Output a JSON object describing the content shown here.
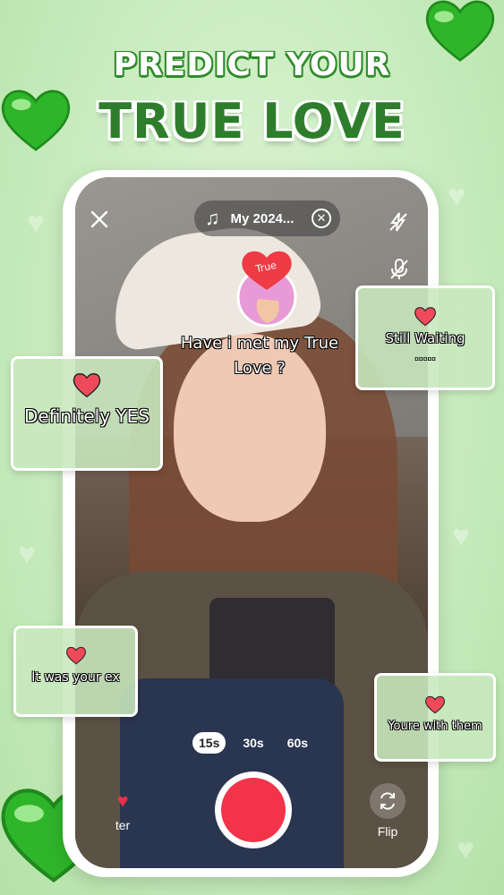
{
  "header": {
    "line1": "PREDICT YOUR",
    "line2": "TRUE LOVE"
  },
  "music": {
    "song": "My 2024..."
  },
  "question": {
    "badge": "True",
    "text": "Have i met my True Love ?"
  },
  "cards": {
    "left_top": "Definitely YES",
    "right_top_line1": "Still Waiting",
    "right_top_line2": ".....",
    "left_bottom": "It was your ex",
    "right_bottom": "Youre with them"
  },
  "durations": [
    "15s",
    "30s",
    "60s"
  ],
  "selected_duration": "15s",
  "controls": {
    "flip_label": "Flip",
    "filter_label_visible": "ter"
  },
  "colors": {
    "accent_green": "#2e7d2c",
    "record_red": "#f2334a",
    "heart_red": "#ef4a5a"
  },
  "icons": [
    "close-icon",
    "music-note-icon",
    "clear-song-icon",
    "flash-off-icon",
    "mic-off-icon",
    "heart-icon",
    "flip-camera-icon",
    "filter-heart-icon"
  ]
}
